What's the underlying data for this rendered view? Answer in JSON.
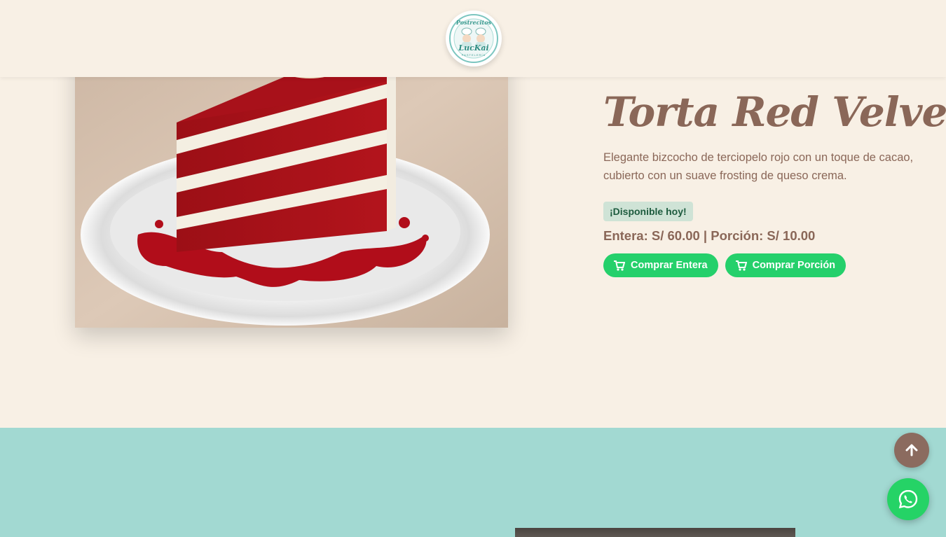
{
  "header": {
    "logo_text_top": "Postrecitos",
    "logo_text_main": "LucKai",
    "logo_text_sub": "PASTELERÍA",
    "logo_icon": "bakers-logo-icon"
  },
  "product": {
    "image_icon": "red-velvet-cake-photo",
    "title": "Torta Red Velvet",
    "description": "Elegante bizcocho de terciopelo rojo con un toque de cacao, cubierto con un suave frosting de queso crema.",
    "availability": "¡Disponible hoy!",
    "price": "Entera: S/ 60.00 | Porción: S/ 10.00",
    "buttons": [
      {
        "label": "Comprar Entera",
        "icon": "cart-icon"
      },
      {
        "label": "Comprar Porción",
        "icon": "cart-icon"
      }
    ]
  },
  "floating": {
    "scroll_top_icon": "arrow-up-icon",
    "whatsapp_icon": "whatsapp-icon"
  },
  "colors": {
    "background": "#f8f0e5",
    "brown": "#8a6758",
    "green_button": "#25d06b",
    "badge_bg": "#cfe3d6",
    "badge_text": "#1d5b3e",
    "teal": "#a2d9d2",
    "whatsapp": "#25d366"
  }
}
